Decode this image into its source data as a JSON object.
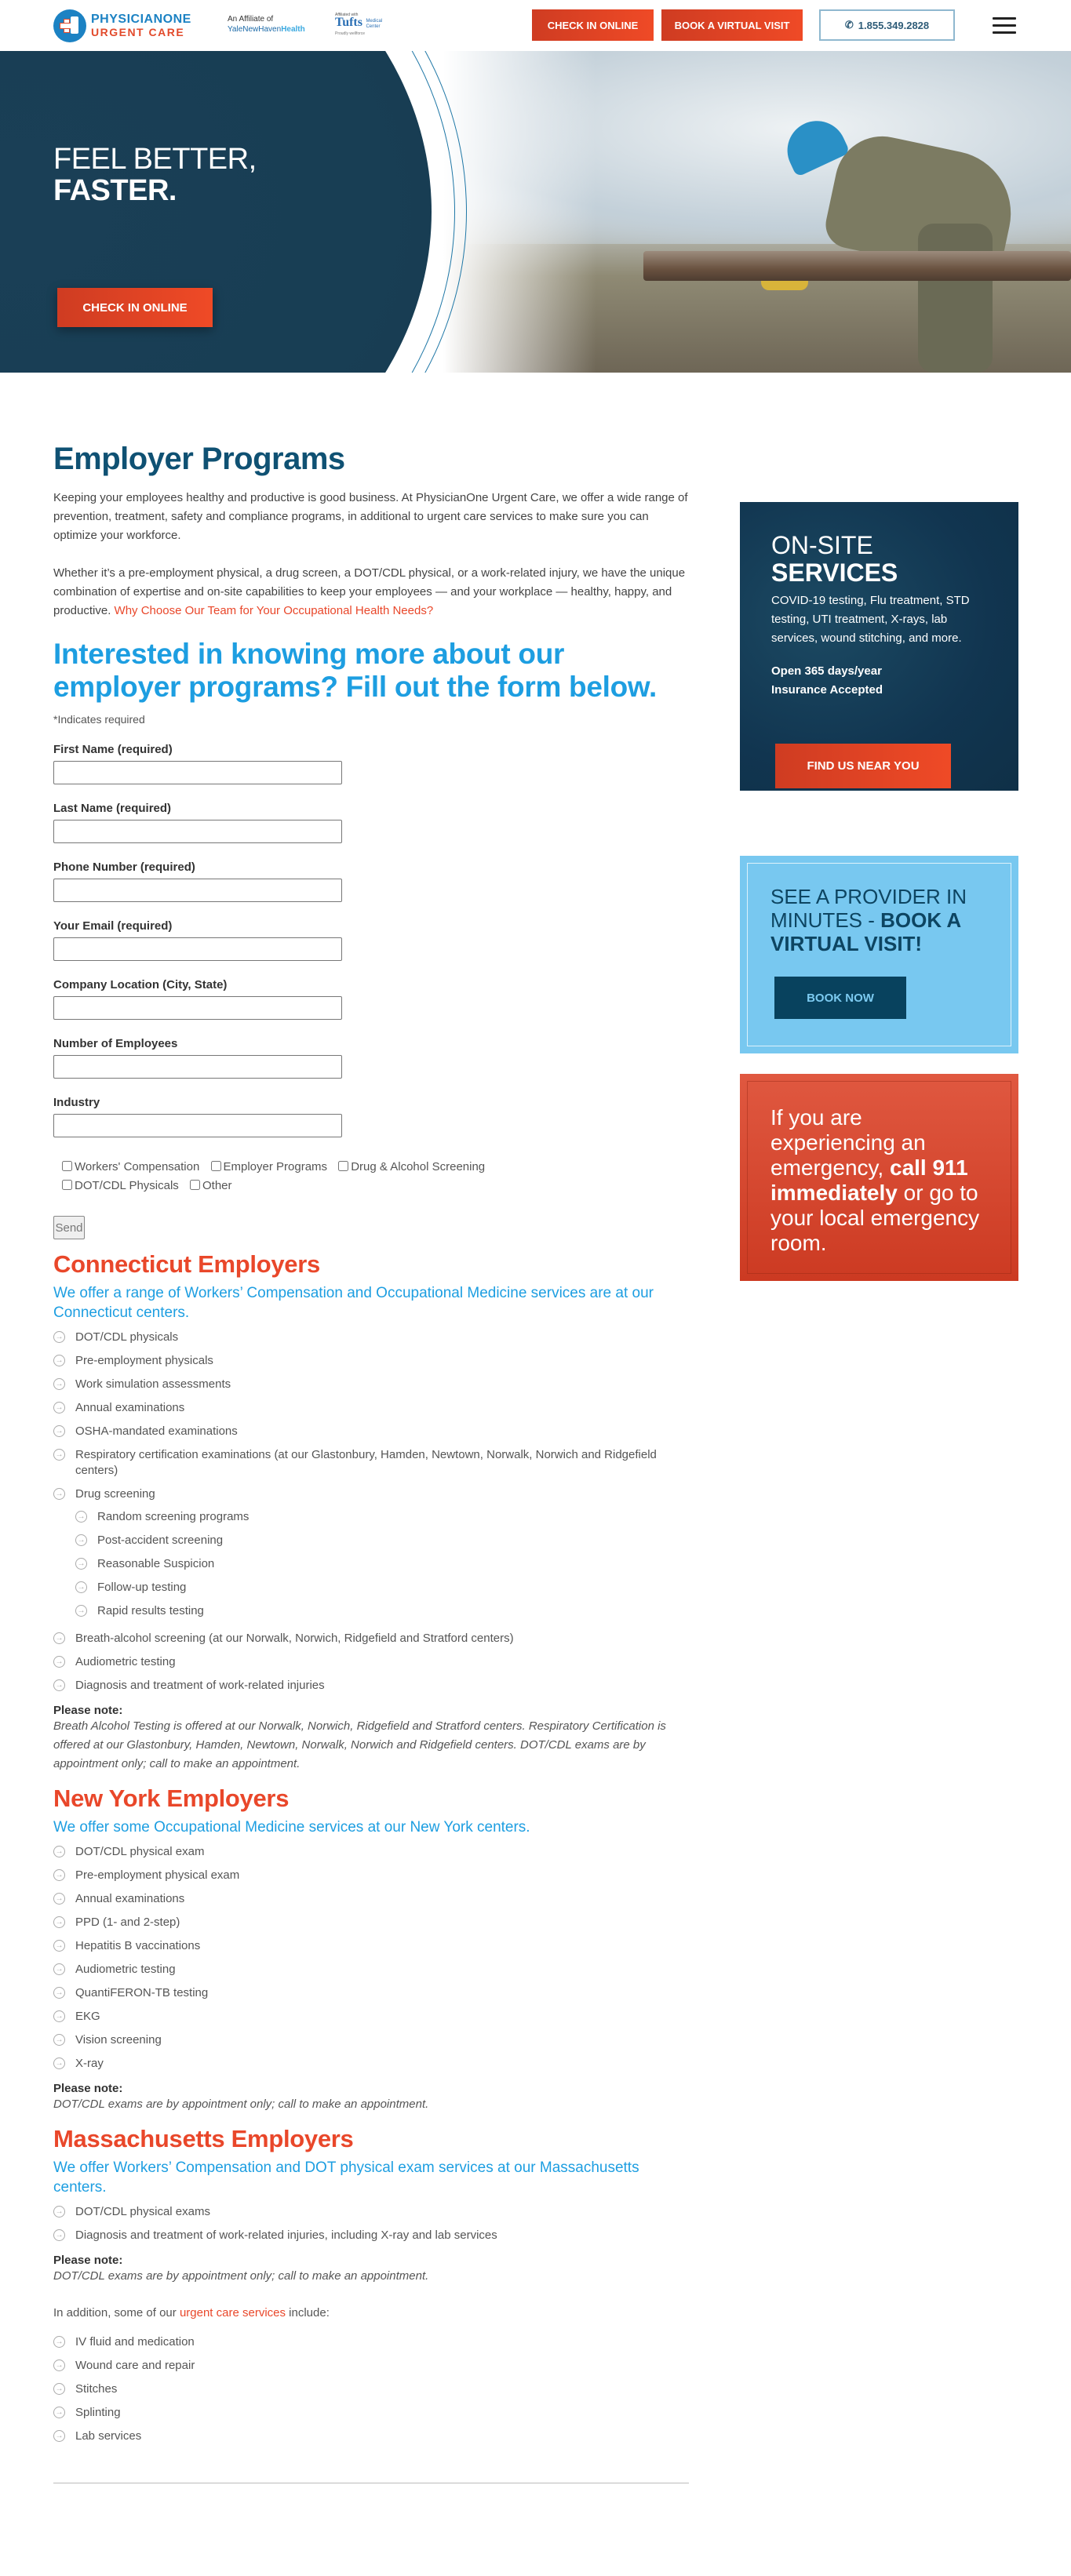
{
  "header": {
    "logo_line1": "PHYSICIANONE",
    "logo_line2": "URGENT CARE",
    "affiliate_line1": "An Affiliate of",
    "affiliate_yale": "YaleNewHaven",
    "affiliate_health": "Health",
    "tufts_small": "Affiliated with",
    "tufts_name": "Tufts",
    "tufts_medical": "Medical",
    "tufts_center": "Center",
    "tufts_wellforce": "Proudly wellforce",
    "check_in_label": "CHECK IN ONLINE",
    "virtual_visit_label": "BOOK A VIRTUAL VISIT",
    "phone_label": "1.855.349.2828",
    "phone_icon": "phone-icon",
    "menu_icon": "hamburger-icon"
  },
  "hero": {
    "title_line1": "FEEL BETTER,",
    "title_line2": "FASTER.",
    "cta_label": "CHECK IN ONLINE"
  },
  "main": {
    "title": "Employer Programs",
    "intro_p1": "Keeping your employees healthy and productive is good business. At PhysicianOne Urgent Care, we offer a wide range of prevention, treatment, safety and compliance  programs, in additional to urgent care services to make sure you can optimize your workforce.",
    "intro_p2": "Whether it’s a pre-employment physical, a drug screen, a DOT/CDL physical, or a work-related injury, we have the unique combination of expertise and on-site capabilities to keep your employees — and your workplace — healthy, happy, and productive. ",
    "intro_link": "Why Choose Our Team for Your Occupational Health Needs?",
    "form_heading": "Interested in knowing more about our employer programs? Fill out the form below.",
    "required_note": "*Indicates required",
    "fields": [
      {
        "label": "First Name (required)",
        "value": "",
        "placeholder": ""
      },
      {
        "label": "Last Name (required)",
        "value": "",
        "placeholder": ""
      },
      {
        "label": "Phone Number (required)",
        "value": "",
        "placeholder": ""
      },
      {
        "label": "Your Email (required)",
        "value": "",
        "placeholder": ""
      },
      {
        "label": "Company Location (City, State)",
        "value": "",
        "placeholder": ""
      },
      {
        "label": "Number of Employees",
        "value": "",
        "placeholder": ""
      },
      {
        "label": "Industry",
        "value": "",
        "placeholder": ""
      }
    ],
    "checkboxes": [
      {
        "label": "Workers' Compensation",
        "checked": false
      },
      {
        "label": "Employer Programs",
        "checked": false
      },
      {
        "label": "Drug & Alcohol Screening",
        "checked": false
      },
      {
        "label": "DOT/CDL Physicals",
        "checked": false
      },
      {
        "label": "Other",
        "checked": false
      }
    ],
    "send_label": "Send",
    "ct": {
      "title": "Connecticut Employers",
      "subtitle": "We offer a range of Workers’ Compensation and Occupational Medicine services are at our Connecticut centers.",
      "items": [
        "DOT/CDL physicals",
        "Pre-employment physicals",
        "Work simulation assessments",
        "Annual examinations",
        "OSHA-mandated examinations",
        "Respiratory certification examinations (at our Glastonbury, Hamden, Newtown, Norwalk, Norwich and Ridgefield centers)",
        "Drug screening"
      ],
      "sub_items": [
        "Random screening programs",
        "Post-accident screening",
        "Reasonable Suspicion",
        "Follow-up testing",
        "Rapid results testing"
      ],
      "items_after": [
        "Breath-alcohol screening (at our Norwalk, Norwich, Ridgefield and Stratford centers)",
        "Audiometric testing",
        "Diagnosis and treatment of work-related injuries"
      ],
      "note_heading": "Please note:",
      "note": "Breath Alcohol Testing is offered at our Norwalk, Norwich, Ridgefield and Stratford centers. Respiratory Certification is offered at our Glastonbury, Hamden, Newtown, Norwalk, Norwich and Ridgefield centers. DOT/CDL exams are by appointment only; call to make an appointment."
    },
    "ny": {
      "title": "New York Employers",
      "subtitle": "We offer some Occupational Medicine services at our New York centers.",
      "items": [
        "DOT/CDL physical exam",
        "Pre-employment physical exam",
        "Annual examinations",
        "PPD (1- and 2-step)",
        "Hepatitis B vaccinations",
        "Audiometric testing",
        "QuantiFERON-TB testing",
        "EKG",
        "Vision screening",
        "X-ray"
      ],
      "note_heading": "Please note:",
      "note": "DOT/CDL exams are by appointment only; call to make an appointment."
    },
    "ma": {
      "title": "Massachusetts Employers",
      "subtitle": "We offer Workers’ Compensation and DOT physical exam services at our Massachusetts centers.",
      "items": [
        "DOT/CDL physical exams",
        "Diagnosis and treatment of work-related injuries, including X-ray and lab services"
      ],
      "note_heading": "Please note:",
      "note": "DOT/CDL exams are by appointment only; call to make an appointment."
    },
    "additional_prefix": "In addition, some of our ",
    "additional_link": "urgent care services",
    "additional_suffix": " include:",
    "additional_items": [
      "IV fluid and medication",
      "Wound care and repair",
      "Stitches",
      "Splinting",
      "Lab services"
    ]
  },
  "sidebar": {
    "onsite_line1": "ON-SITE",
    "onsite_line2": "SERVICES",
    "onsite_desc": "COVID-19 testing, Flu treatment, STD testing, UTI treatment, X-rays, lab services, wound stitching, and more.",
    "onsite_open": "Open 365 days/year",
    "onsite_insurance": "Insurance Accepted",
    "find_label": "FIND US NEAR YOU",
    "virtual_text": "SEE A PROVIDER IN MINUTES - ",
    "virtual_bold": "BOOK A VIRTUAL VISIT!",
    "book_label": "BOOK NOW",
    "emergency_pre": "If you are experiencing an emergency, ",
    "emergency_bold": "call 911 immediately",
    "emergency_post": " or go to your local emergency room."
  },
  "colors": {
    "brand_blue": "#0f5173",
    "accent_orange": "#e9472a",
    "link_blue": "#1d9ee1",
    "sky_box": "#78c8f0"
  }
}
